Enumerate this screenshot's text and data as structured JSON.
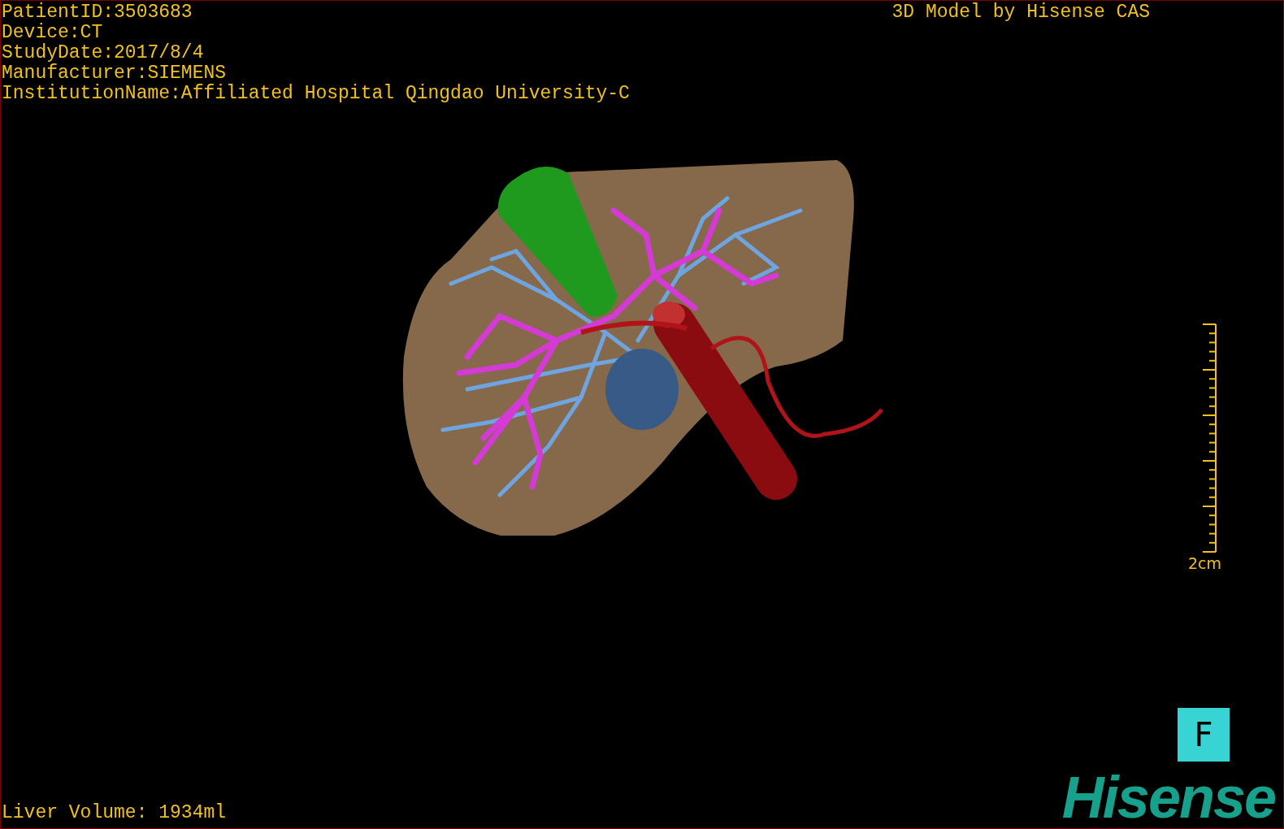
{
  "info_lines": [
    "PatientID:3503683",
    "Device:CT",
    "StudyDate:2017/8/4",
    "Manufacturer:SIEMENS",
    "InstitutionName:Affiliated Hospital Qingdao University-C"
  ],
  "title": "3D Model by Hisense CAS",
  "scale": {
    "label": "2cm"
  },
  "orientation_cube": {
    "label": "F"
  },
  "liver_volume": "Liver Volume: 1934ml",
  "logo": "Hisense"
}
